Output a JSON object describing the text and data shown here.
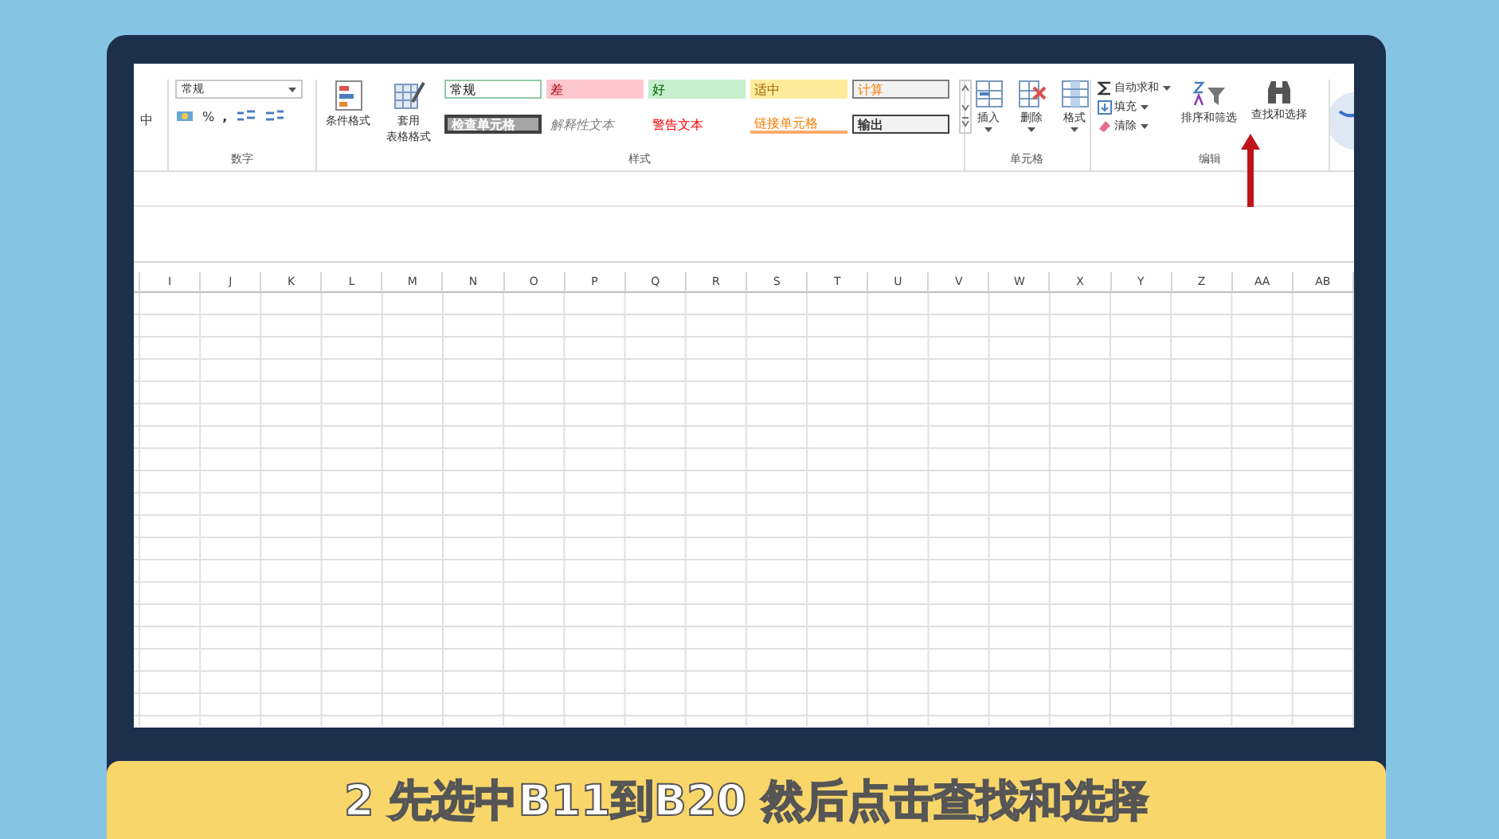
{
  "ribbon": {
    "cut_label": "中",
    "number_group": {
      "format_value": "常规",
      "percent": "%",
      "comma": ",",
      "title": "数字"
    },
    "styles_group": {
      "buttons": [
        {
          "lines": [
            "条件格式"
          ]
        },
        {
          "lines": [
            "套用",
            "表格格式"
          ]
        }
      ],
      "cell_styles": [
        "常规",
        "差",
        "好",
        "适中",
        "计算",
        "检查单元格",
        "解释性文本",
        "警告文本",
        "链接单元格",
        "输出"
      ],
      "title": "样式"
    },
    "cells_group": {
      "buttons": [
        "插入",
        "删除",
        "格式"
      ],
      "title": "单元格"
    },
    "editing_group": {
      "small_buttons": [
        "自动求和",
        "填充",
        "清除"
      ],
      "buttons": [
        "排序和筛选",
        "查找和选择"
      ],
      "title": "编辑"
    }
  },
  "sheet": {
    "columns": [
      "I",
      "J",
      "K",
      "L",
      "M",
      "N",
      "O",
      "P",
      "Q",
      "R",
      "S",
      "T",
      "U",
      "V",
      "W",
      "X",
      "Y",
      "Z",
      "AA",
      "AB"
    ]
  },
  "caption": "2 先选中B11到B20 然后点击查找和选择"
}
